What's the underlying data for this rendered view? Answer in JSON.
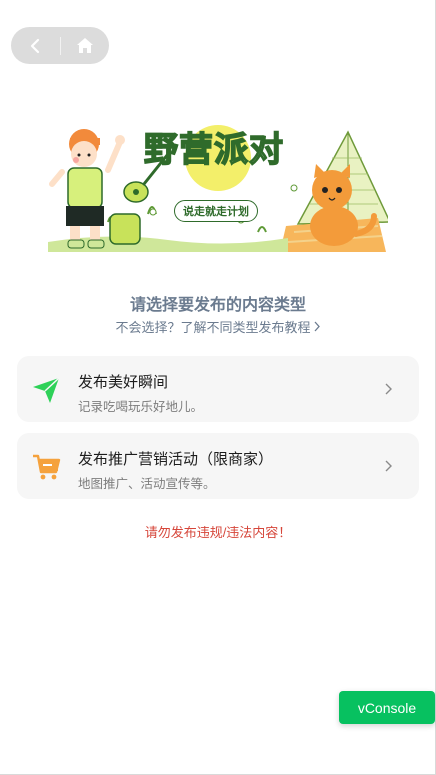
{
  "banner": {
    "headline": "野营派对",
    "slogan": "说走就走计划"
  },
  "main": {
    "title": "请选择要发布的内容类型",
    "help_link": "不会选择？了解不同类型发布教程",
    "options": [
      {
        "title": "发布美好瞬间",
        "desc": "记录吃喝玩乐好地儿。",
        "icon": "paper-plane-icon",
        "color": "#2ed158"
      },
      {
        "title": "发布推广营销活动（限商家）",
        "desc": "地图推广、活动宣传等。",
        "icon": "shopping-cart-icon",
        "color": "#f5a23d"
      }
    ],
    "warning": "请勿发布违规/违法内容！"
  },
  "debug": {
    "vconsole_label": "vConsole"
  },
  "colors": {
    "accent_green": "#07c160",
    "warning_red": "#d6463a",
    "title_gray": "#6b7b8f"
  }
}
